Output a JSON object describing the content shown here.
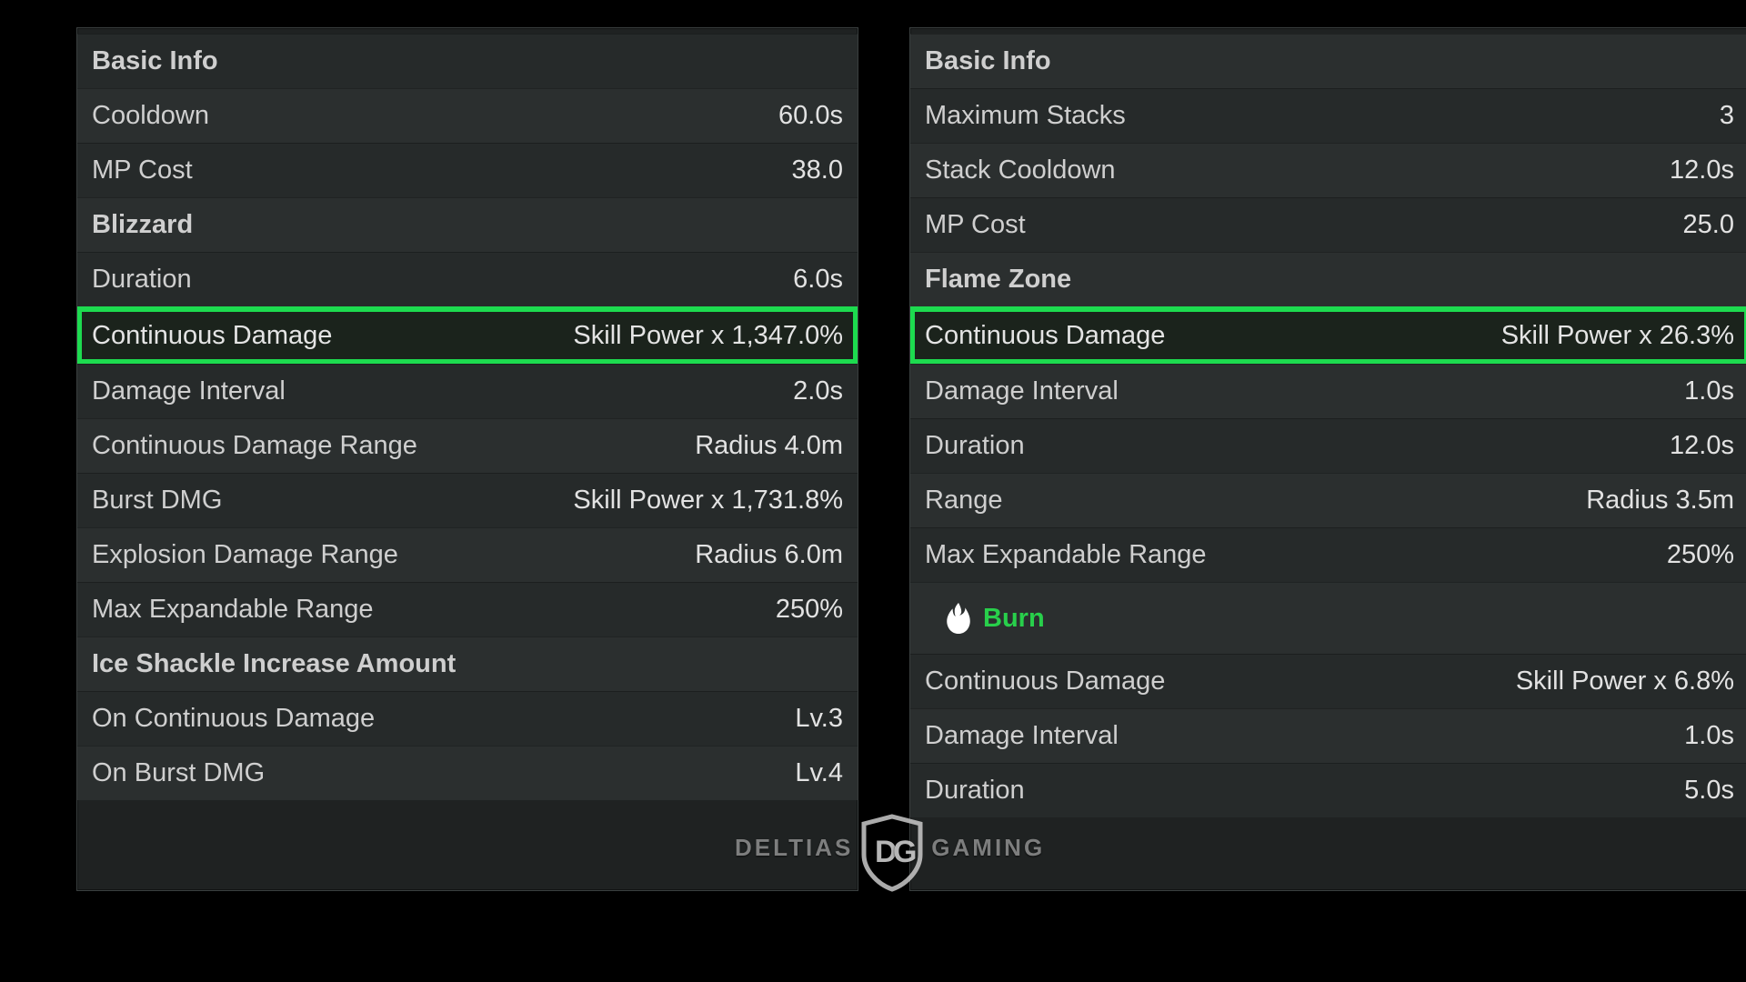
{
  "left_panel": {
    "section1": {
      "title": "Basic Info"
    },
    "cooldown": {
      "label": "Cooldown",
      "value": "60.0s"
    },
    "mp_cost": {
      "label": "MP Cost",
      "value": "38.0"
    },
    "section2": {
      "title": "Blizzard"
    },
    "duration": {
      "label": "Duration",
      "value": "6.0s"
    },
    "cont_dmg": {
      "label": "Continuous Damage",
      "value": "Skill Power x 1,347.0%"
    },
    "dmg_interval": {
      "label": "Damage Interval",
      "value": "2.0s"
    },
    "cont_dmg_range": {
      "label": "Continuous Damage Range",
      "value": "Radius 4.0m"
    },
    "burst_dmg": {
      "label": "Burst DMG",
      "value": "Skill Power x 1,731.8%"
    },
    "expl_range": {
      "label": "Explosion Damage Range",
      "value": "Radius 6.0m"
    },
    "max_expand": {
      "label": "Max Expandable Range",
      "value": "250%"
    },
    "section3": {
      "title": "Ice Shackle Increase Amount"
    },
    "on_cont": {
      "label": "On Continuous Damage",
      "value": "Lv.3"
    },
    "on_burst": {
      "label": "On Burst DMG",
      "value": "Lv.4"
    }
  },
  "right_panel": {
    "section1": {
      "title": "Basic Info"
    },
    "max_stacks": {
      "label": "Maximum Stacks",
      "value": "3"
    },
    "stack_cd": {
      "label": "Stack Cooldown",
      "value": "12.0s"
    },
    "mp_cost": {
      "label": "MP Cost",
      "value": "25.0"
    },
    "section2": {
      "title": "Flame Zone"
    },
    "cont_dmg": {
      "label": "Continuous Damage",
      "value": "Skill Power x 26.3%"
    },
    "dmg_interval": {
      "label": "Damage Interval",
      "value": "1.0s"
    },
    "duration": {
      "label": "Duration",
      "value": "12.0s"
    },
    "range": {
      "label": "Range",
      "value": "Radius 3.5m"
    },
    "max_expand": {
      "label": "Max Expandable Range",
      "value": "250%"
    },
    "burn_section": {
      "title": "Burn"
    },
    "burn_cont": {
      "label": "Continuous Damage",
      "value": "Skill Power x 6.8%"
    },
    "burn_interval": {
      "label": "Damage Interval",
      "value": "1.0s"
    },
    "burn_duration": {
      "label": "Duration",
      "value": "5.0s"
    }
  },
  "watermark": {
    "left": "DELTIAS",
    "right": "GAMING"
  },
  "colors": {
    "accent": "#28cf4b",
    "highlight": "#1ddb4f"
  }
}
